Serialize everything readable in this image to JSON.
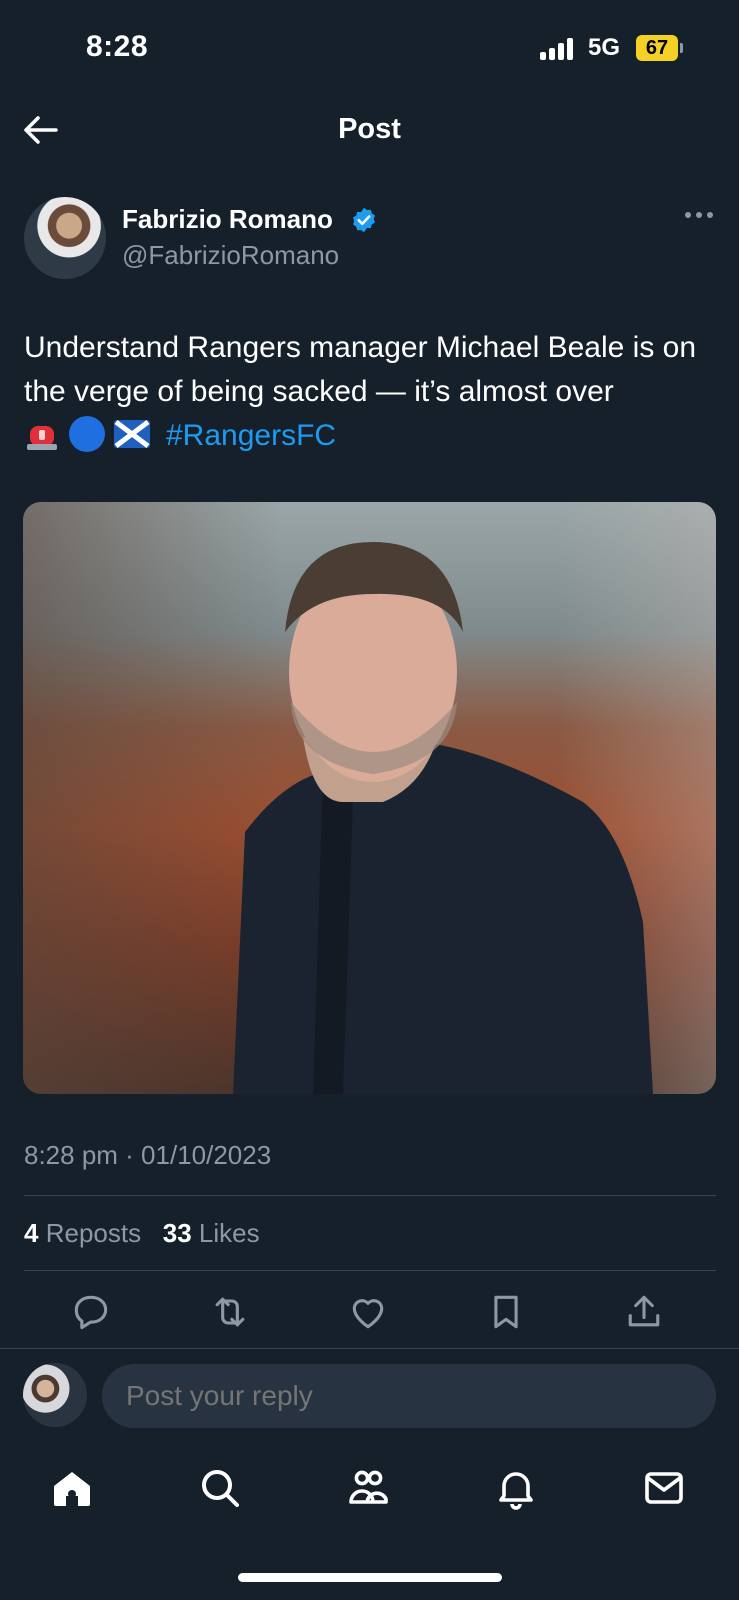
{
  "status_bar": {
    "time": "8:28",
    "network": "5G",
    "battery": "67"
  },
  "header": {
    "title": "Post"
  },
  "author": {
    "name": "Fabrizio Romano",
    "handle": "@FabrizioRomano"
  },
  "post": {
    "text": "Understand Rangers manager Michael Beale is on the verge of being sacked — it’s almost over",
    "emojis": [
      "🚨",
      "🔵",
      "🏴"
    ],
    "hashtag": "#RangersFC",
    "timestamp": "8:28 pm · 01/10/2023"
  },
  "stats": {
    "reposts_count": "4",
    "reposts_label": "Reposts",
    "likes_count": "33",
    "likes_label": "Likes"
  },
  "actions": [
    "reply-icon",
    "repost-icon",
    "like-icon",
    "bookmark-icon",
    "share-icon"
  ],
  "reply": {
    "placeholder": "Post your reply"
  },
  "nav": [
    "home-icon",
    "search-icon",
    "communities-icon",
    "notifications-icon",
    "messages-icon"
  ],
  "colors": {
    "background": "#15202b",
    "accent": "#1d9bf0",
    "muted": "#8b98a5"
  }
}
